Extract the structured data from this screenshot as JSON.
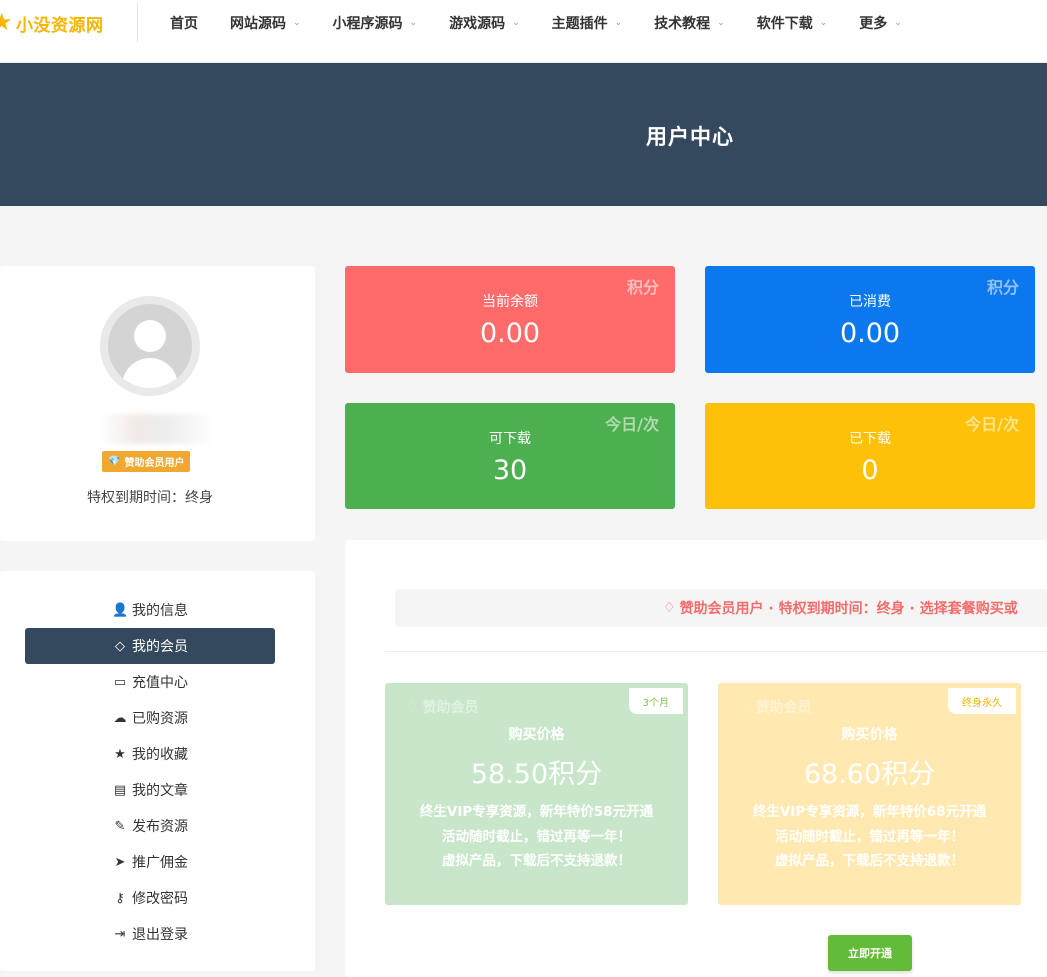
{
  "header": {
    "logo_text": "小没资源网",
    "nav": [
      {
        "label": "首页",
        "has_caret": false
      },
      {
        "label": "网站源码",
        "has_caret": true
      },
      {
        "label": "小程序源码",
        "has_caret": true
      },
      {
        "label": "游戏源码",
        "has_caret": true
      },
      {
        "label": "主题插件",
        "has_caret": true
      },
      {
        "label": "技术教程",
        "has_caret": true
      },
      {
        "label": "软件下载",
        "has_caret": true
      },
      {
        "label": "更多",
        "has_caret": true
      }
    ]
  },
  "hero": {
    "title": "用户中心"
  },
  "profile": {
    "badge": "赞助会员用户",
    "expire_text": "特权到期时间：终身"
  },
  "menu": {
    "items": [
      {
        "label": "我的信息",
        "icon": "user-icon",
        "active": false
      },
      {
        "label": "我的会员",
        "icon": "diamond-icon",
        "active": true
      },
      {
        "label": "充值中心",
        "icon": "credit-card-icon",
        "active": false
      },
      {
        "label": "已购资源",
        "icon": "cloud-download-icon",
        "active": false
      },
      {
        "label": "我的收藏",
        "icon": "star-icon",
        "active": false
      },
      {
        "label": "我的文章",
        "icon": "file-icon",
        "active": false
      },
      {
        "label": "发布资源",
        "icon": "pencil-icon",
        "active": false
      },
      {
        "label": "推广佣金",
        "icon": "paper-plane-icon",
        "active": false
      },
      {
        "label": "修改密码",
        "icon": "key-icon",
        "active": false
      },
      {
        "label": "退出登录",
        "icon": "sign-out-icon",
        "active": false
      }
    ]
  },
  "stats": {
    "balance": {
      "label": "当前余额",
      "value": "0.00",
      "unit": "积分",
      "color": "#ff6b6b"
    },
    "spent": {
      "label": "已消费",
      "value": "0.00",
      "unit": "积分",
      "color": "#0b78ee"
    },
    "can_download": {
      "label": "可下载",
      "value": "30",
      "unit": "今日/次",
      "color": "#4caf50"
    },
    "downloaded": {
      "label": "已下载",
      "value": "0",
      "unit": "今日/次",
      "color": "#ffc107"
    }
  },
  "vip": {
    "notice": "赞助会员用户 · 特权到期时间：终身 · 选择套餐购买或",
    "plans": [
      {
        "name": "赞助会员",
        "tag": "3个月",
        "price_label": "购买价格",
        "price": "58.50积分",
        "desc1": "终生VIP专享资源，新年特价58元开通",
        "desc2": "活动随时截止，错过再等一年！",
        "desc3": "虚拟产品，下载后不支持退款！",
        "color": "#c8e6c9",
        "tag_color": "#8bc34a"
      },
      {
        "name": "赞助会员",
        "tag": "终身永久",
        "price_label": "购买价格",
        "price": "68.60积分",
        "desc1": "终生VIP专享资源，新年特价68元开通",
        "desc2": "活动随时截止，错过再等一年！",
        "desc3": "虚拟产品，下载后不支持退款！",
        "color": "#ffe9b0",
        "tag_color": "#ffc107"
      }
    ],
    "buy_button": "立即开通"
  }
}
